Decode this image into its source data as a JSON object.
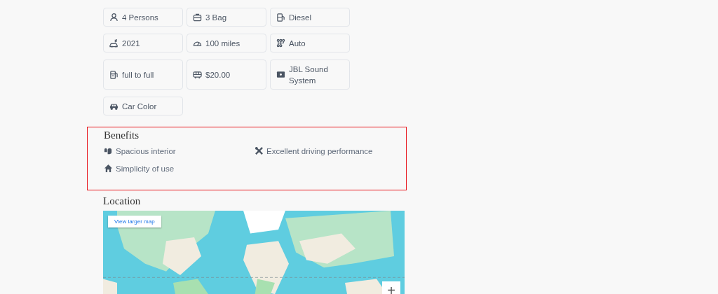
{
  "specs": [
    {
      "label": "4 Persons"
    },
    {
      "label": "3 Bag"
    },
    {
      "label": "Diesel"
    },
    {
      "label": "2021"
    },
    {
      "label": "100 miles"
    },
    {
      "label": "Auto"
    },
    {
      "label": "full to full"
    },
    {
      "label": "$20.00"
    },
    {
      "label": "JBL Sound System"
    },
    {
      "label": "Car Color"
    }
  ],
  "benefits": {
    "title": "Benefits",
    "items": [
      {
        "label": "Spacious interior"
      },
      {
        "label": "Excellent driving performance"
      },
      {
        "label": "Simplicity of use"
      }
    ]
  },
  "location": {
    "title": "Location",
    "map": {
      "kind": "picture",
      "link": "View larger map",
      "zoom_in": "+"
    }
  }
}
